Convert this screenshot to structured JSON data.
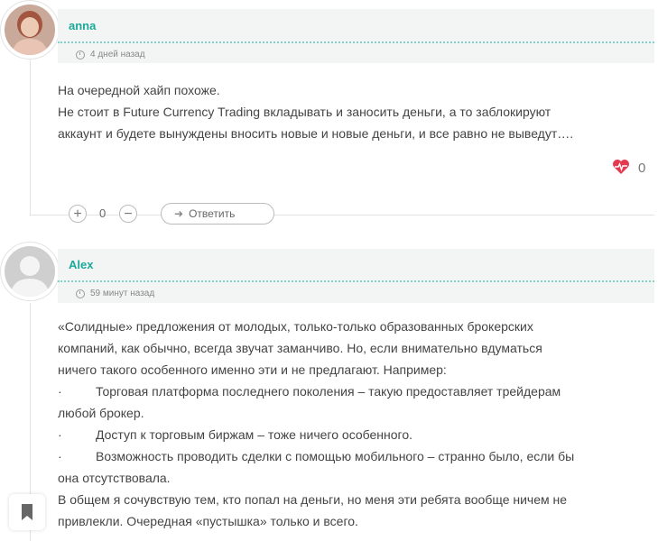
{
  "comments": [
    {
      "author": "anna",
      "date": "4 дней назад",
      "lines": [
        "На очередной хайп похоже.",
        "Не стоит в Future Currency Trading вкладывать и заносить деньги, а то заблокируют",
        "аккаунт и будете вынуждены вносить новые и новые деньги, и все равно не выведут…."
      ],
      "likes": "0",
      "votes": "0",
      "reply_label": "Ответить"
    },
    {
      "author": "Alex",
      "date": "59 минут назад",
      "lines": [
        "«Солидные» предложения от молодых, только-только образованных брокерских",
        "компаний, как обычно, всегда звучат заманчиво. Но, если внимательно вдуматься",
        "ничего такого особенного именно эти и не предлагают. Например:"
      ],
      "bullets": [
        {
          "marker": "·",
          "first": "Торговая платформа последнего поколения – такую предоставляет трейдерам",
          "rest": "любой брокер."
        },
        {
          "marker": "·",
          "first": "Доступ к торговым биржам – тоже ничего особенного.",
          "rest": ""
        },
        {
          "marker": "·",
          "first": "Возможность проводить сделки с помощью мобильного – странно было, если бы",
          "rest": "она отсутствовала."
        }
      ],
      "closing": [
        "В общем я сочувствую тем, кто попал на деньги, но меня эти ребята вообще ничем не",
        "привлекли. Очередная «пустышка» только и всего."
      ]
    }
  ],
  "icons": {
    "clock": "clock-icon",
    "heart": "heart-pulse-icon",
    "plus": "+",
    "minus": "−",
    "reply": "reply-arrow-icon",
    "bookmark": "bookmark-icon"
  },
  "colors": {
    "accent": "#1ba99a",
    "heart": "#e53950"
  }
}
